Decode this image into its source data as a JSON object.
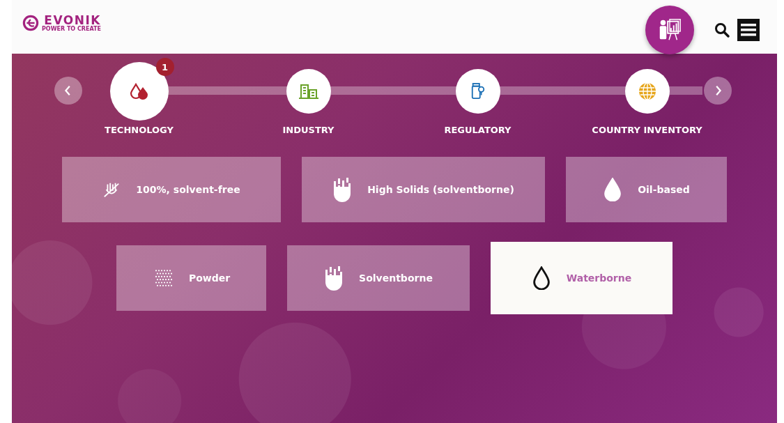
{
  "logo": {
    "name": "EVONIK",
    "tagline": "POWER TO CREATE"
  },
  "steps": [
    {
      "label": "TECHNOLOGY",
      "kind": "drops",
      "selected": true,
      "badge": "1"
    },
    {
      "label": "INDUSTRY",
      "kind": "buildings",
      "selected": false
    },
    {
      "label": "REGULATORY",
      "kind": "jar",
      "selected": false
    },
    {
      "label": "COUNTRY INVENTORY",
      "kind": "globe",
      "selected": false
    }
  ],
  "tile_rows": [
    [
      {
        "label": "100%, solvent-free",
        "kind": "crossed",
        "selected": false
      },
      {
        "label": "High Solids (solventborne)",
        "kind": "solids",
        "selected": false
      },
      {
        "label": "Oil-based",
        "kind": "drop",
        "selected": false
      }
    ],
    [
      {
        "label": "Powder",
        "kind": "dots",
        "selected": false
      },
      {
        "label": "Solventborne",
        "kind": "solids",
        "selected": false
      },
      {
        "label": "Waterborne",
        "kind": "drop",
        "selected": true
      }
    ]
  ]
}
